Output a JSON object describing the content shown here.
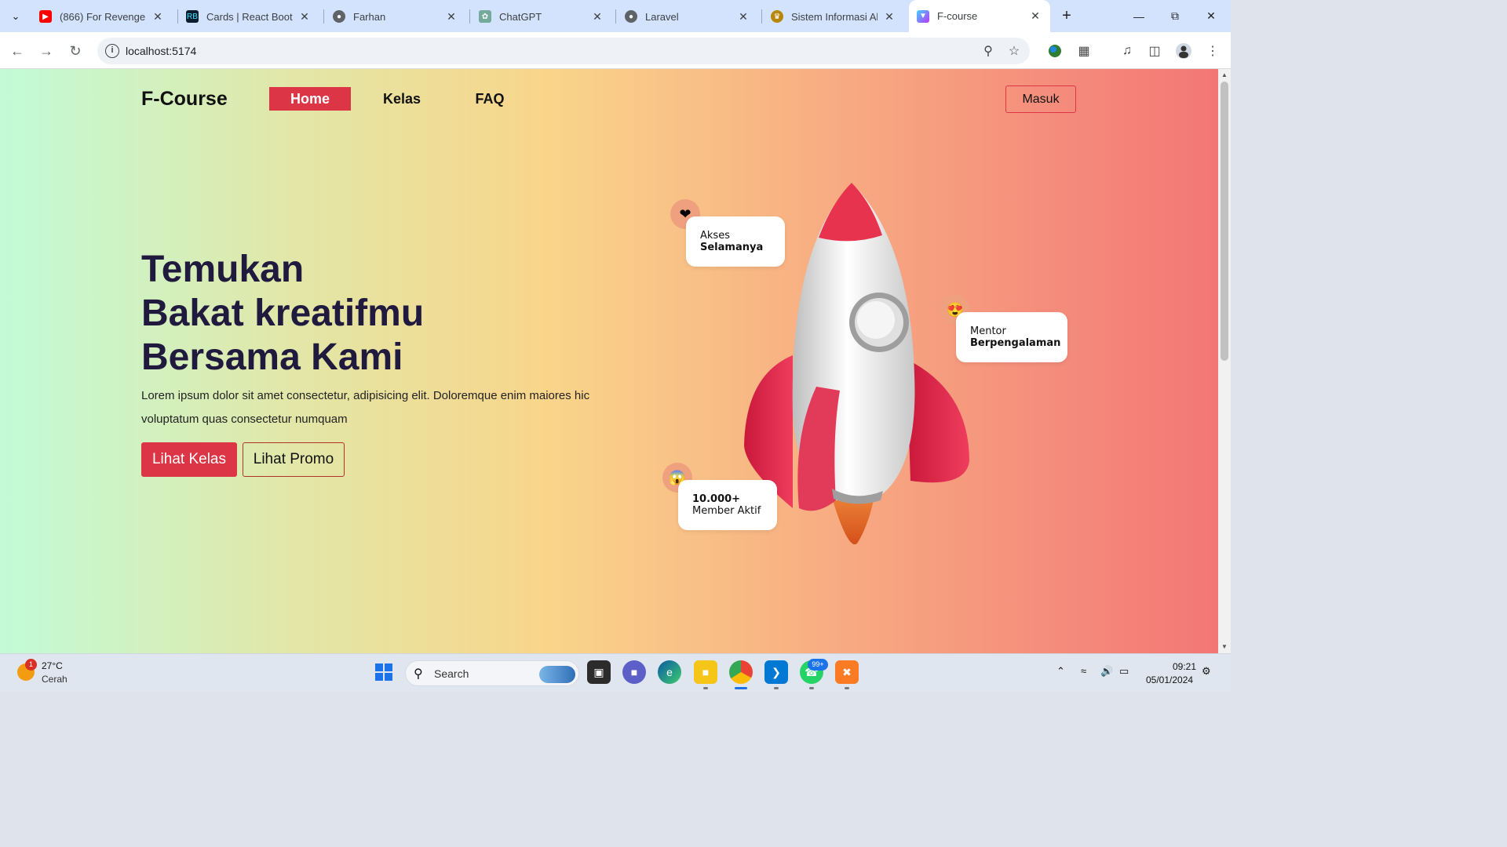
{
  "browser": {
    "tabs": [
      {
        "title": "(866) For Revenge - S",
        "icon": "youtube-icon",
        "color": "#ff0000"
      },
      {
        "title": "Cards | React Bootstr",
        "icon": "react-bootstrap-icon",
        "color": "#0b1e2e"
      },
      {
        "title": "Farhan",
        "icon": "globe-icon",
        "color": "#5f6368"
      },
      {
        "title": "ChatGPT",
        "icon": "chatgpt-icon",
        "color": "#74aa9c"
      },
      {
        "title": "Laravel",
        "icon": "globe-icon",
        "color": "#5f6368"
      },
      {
        "title": "Sistem Informasi Aka",
        "icon": "university-icon",
        "color": "#b8860b"
      },
      {
        "title": "F-course",
        "icon": "vite-icon",
        "color": "#7c4dff",
        "active": true
      }
    ],
    "url": "localhost:5174"
  },
  "page": {
    "brand": "F-Course",
    "nav": {
      "home": "Home",
      "kelas": "Kelas",
      "faq": "FAQ"
    },
    "login_button": "Masuk",
    "hero": {
      "title_line1": "Temukan",
      "title_line2": "Bakat kreatifmu",
      "title_line3": "Bersama Kami",
      "description": "Lorem ipsum dolor sit amet consectetur, adipisicing elit. Doloremque enim maiores hic voluptatum quas consectetur numquam",
      "primary_button": "Lihat Kelas",
      "secondary_button": "Lihat Promo"
    },
    "badges": {
      "akses_line1": "Akses",
      "akses_line2": "Selamanya",
      "mentor_line1": "Mentor",
      "mentor_line2": "Berpengalaman",
      "member_line1": "10.000+",
      "member_line2": "Member Aktif"
    },
    "accent_color": "#dc3545"
  },
  "taskbar": {
    "weather_temp": "27°C",
    "weather_desc": "Cerah",
    "weather_alert": "1",
    "search_placeholder": "Search",
    "whatsapp_badge": "99+",
    "time": "09:21",
    "date": "05/01/2024"
  }
}
